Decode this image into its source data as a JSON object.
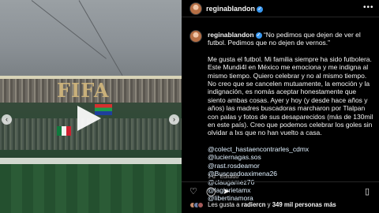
{
  "media": {
    "banner_text": "FIFA",
    "nav_prev": "‹",
    "nav_next": "›"
  },
  "post": {
    "username": "reginablandon",
    "verified": "✓",
    "more": "•••"
  },
  "caption": {
    "username": "reginablandon",
    "quote": "“No pedimos que dejen de ver el futbol. Pedimos que no dejen de vernos.”",
    "paragraph": "Me gusta el futbol. Mi familia siempre ha sido futbolera. Este Mundi4l en México me emociona y me indigna al mismo tiempo. Quiero celebrar y no al mismo tiempo. No creo que se cancelen mutuamente, la emoción y la indignación, es nomás aceptar honestamente que siento ambas cosas. Ayer y hoy (y desde hace años y años) las madres buscadoras marcharon por Tlalpan con palas y fotos de sus desaparecidos (más de 130mil en este país). Creo que podemos celebrar los goles sin olvidar a lxs que no han vuelto a casa.",
    "mentions": [
      "@colect_hastaencontrarles_cdmx",
      "@luciernagas.sos",
      "@rast.rosdeamor",
      "@Buscandoaximena26",
      "@claugamez76",
      "@lagiorietamx",
      "@libertinamora"
    ],
    "time": "1 d",
    "edited": "Editado"
  },
  "actions": {
    "like_icon": "♡",
    "comment_icon": "◯",
    "share_icon": "➤",
    "save_icon": "▯"
  },
  "likes": {
    "prefix": "Les gusta a",
    "user": "radiercn",
    "middle": "y",
    "count": "349 mil personas más"
  }
}
